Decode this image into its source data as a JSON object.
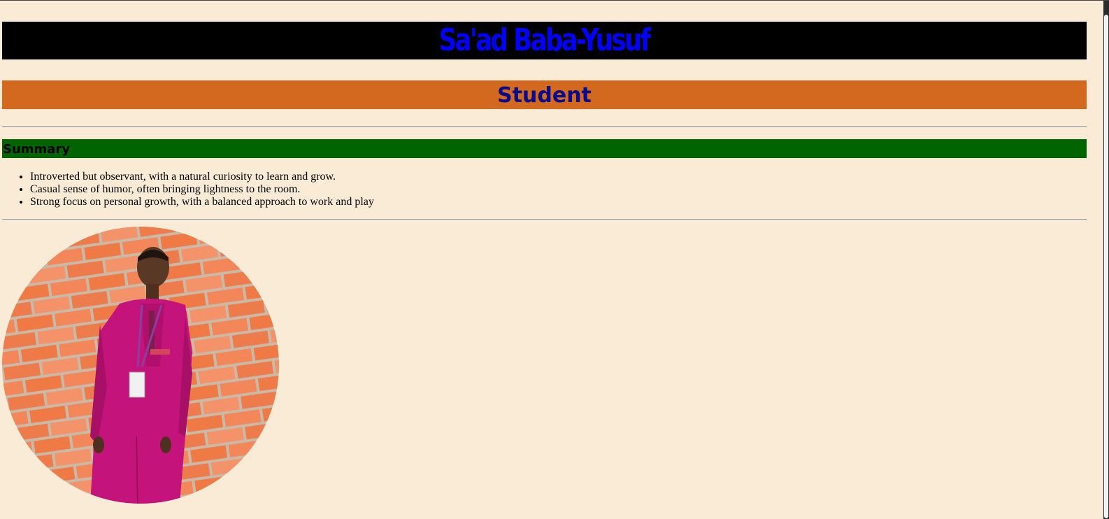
{
  "header": {
    "name": "Sa'ad Baba-Yusuf",
    "role": "Student"
  },
  "summary": {
    "heading": "Summary",
    "items": [
      "Introverted but observant, with a natural curiosity to learn and grow.",
      "Casual sense of humor, often bringing lightness to the room.",
      "Strong focus on personal growth, with a balanced approach to work and play"
    ]
  },
  "colors": {
    "page_background": "#faebd7",
    "name_banner": "#000000",
    "name_text": "#0000ff",
    "role_banner": "#d2691e",
    "role_text": "#0a0a8c",
    "summary_banner": "#006400"
  },
  "photo": {
    "icon": "profile-photo"
  }
}
